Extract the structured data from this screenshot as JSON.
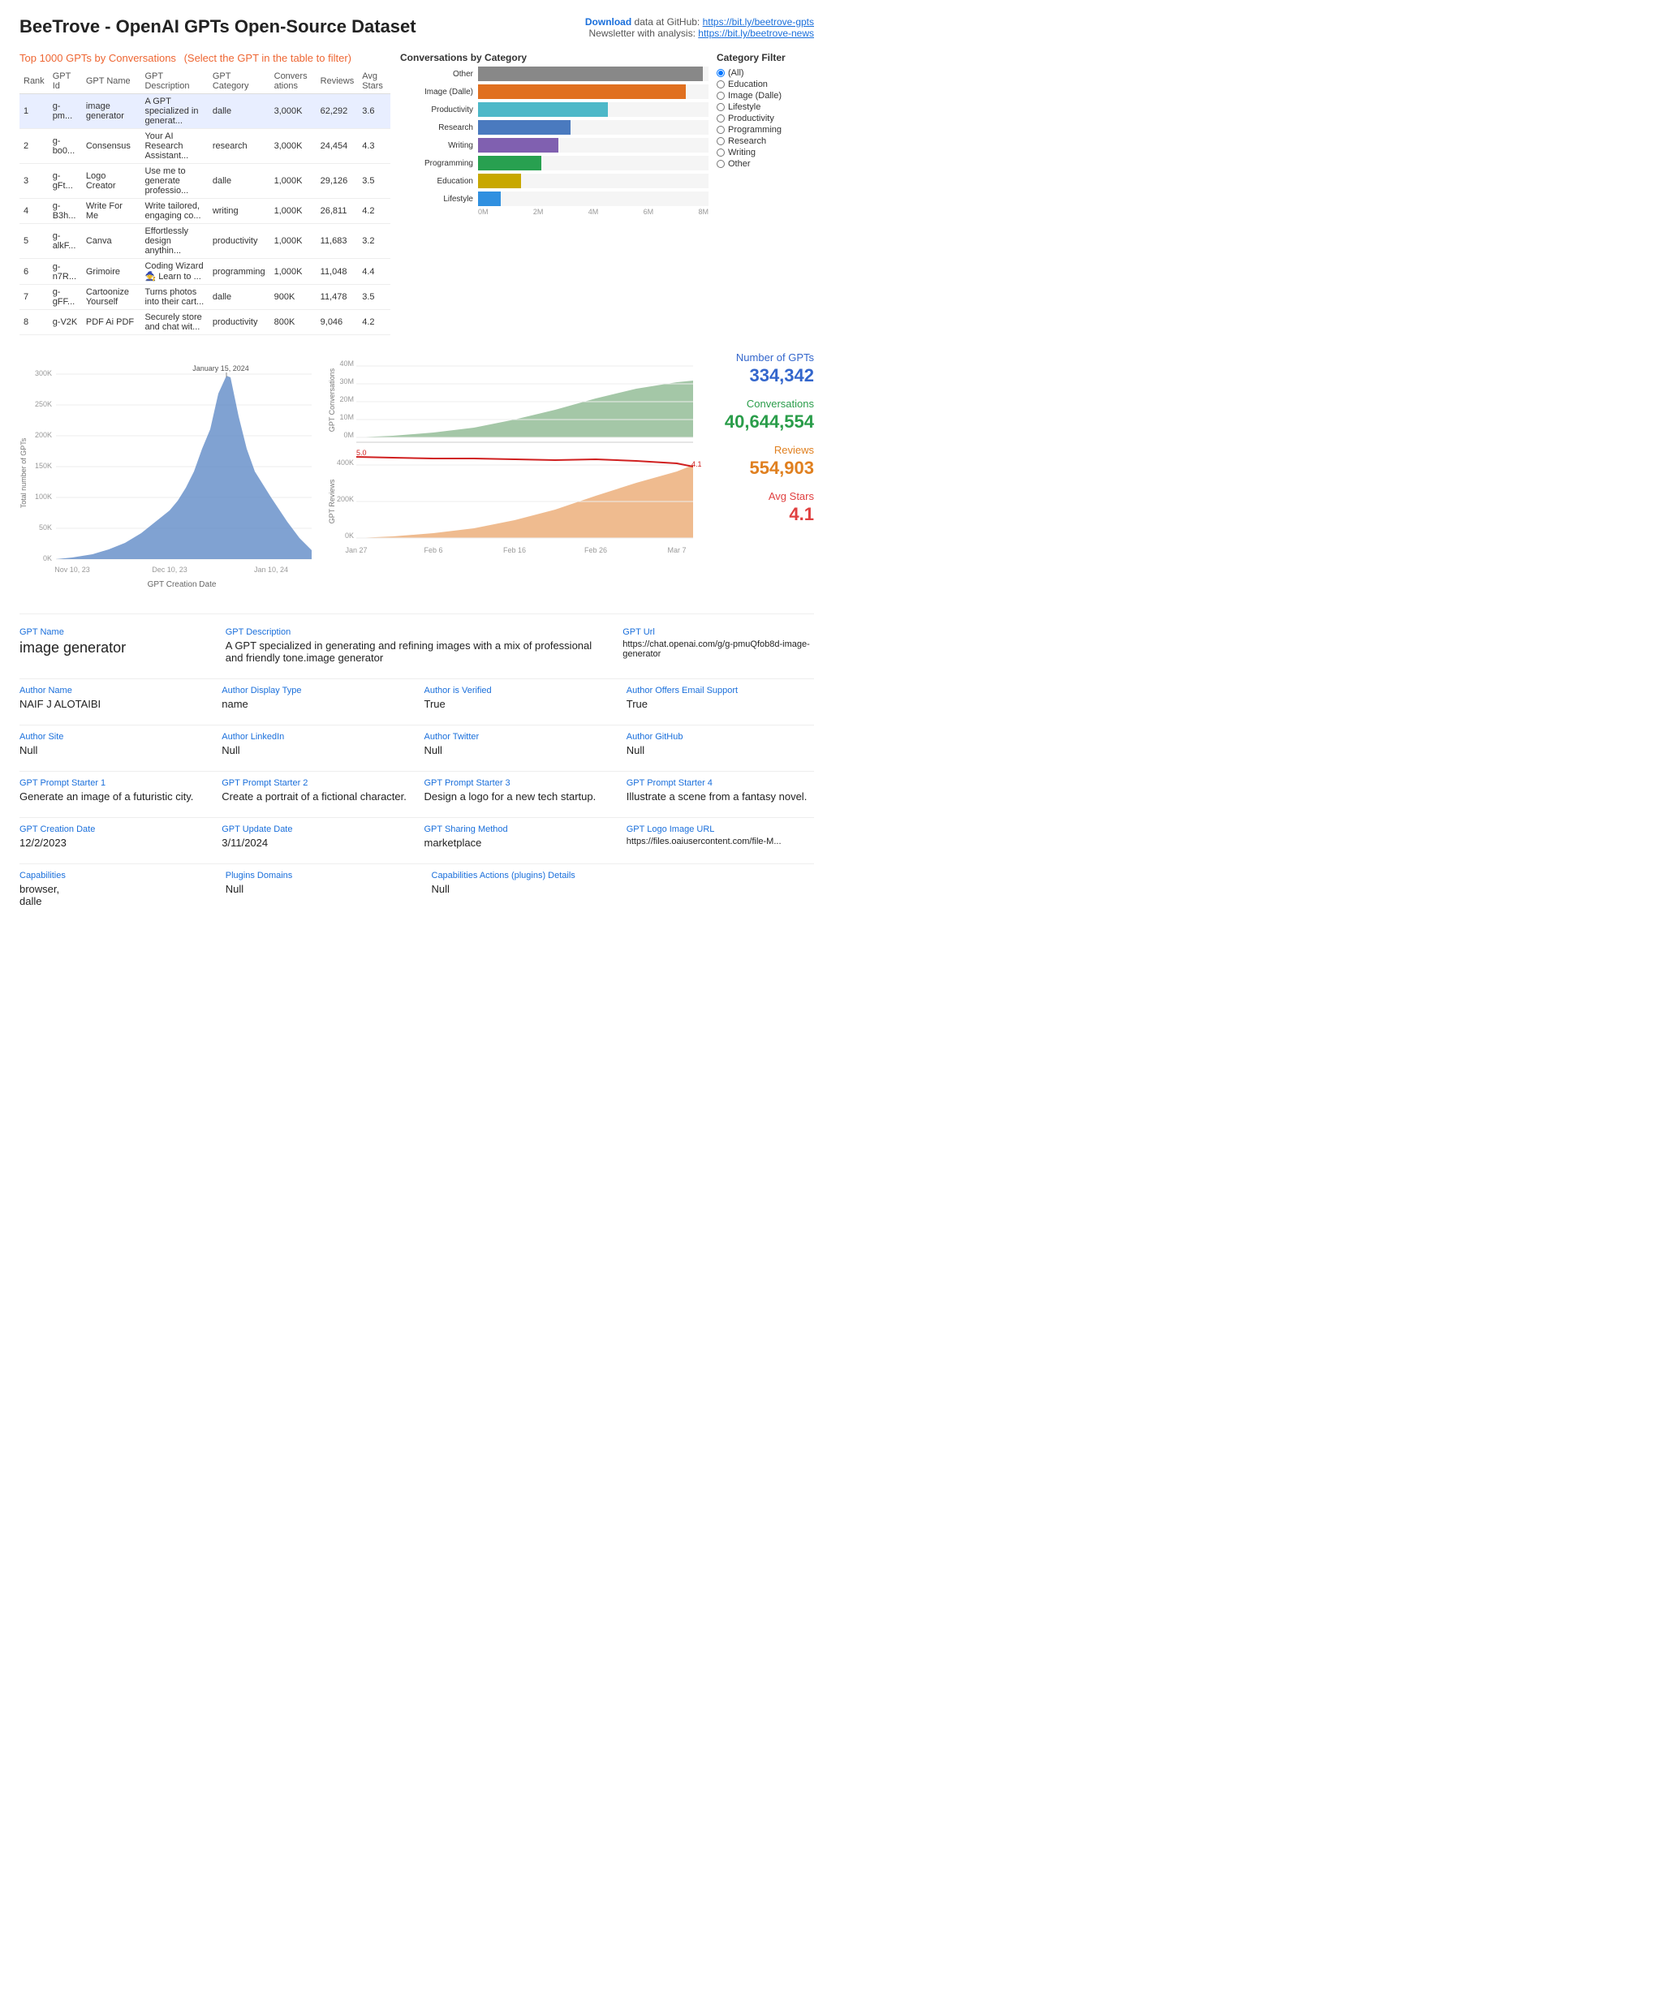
{
  "header": {
    "title": "BeeTrove - OpenAI GPTs Open-Source Dataset",
    "download_text": "Download",
    "data_at": "data at GitHub:",
    "github_url": "https://bit.ly/beetrove-gpts",
    "newsletter_label": "Newsletter",
    "newsletter_with": "with analysis:",
    "newsletter_url": "https://bit.ly/beetrove-news"
  },
  "top_table": {
    "title": "Top 1000 GPTs by Conversations",
    "filter_hint": "(Select the GPT in the table to filter)",
    "columns": [
      "Rank",
      "GPT Id",
      "GPT Name",
      "GPT Description",
      "GPT Category",
      "Conversations",
      "Reviews",
      "Avg Stars"
    ],
    "rows": [
      {
        "rank": "1",
        "id": "g-pm...",
        "name": "image generator",
        "desc": "A GPT specialized in generat...",
        "cat": "dalle",
        "conv": "3,000K",
        "reviews": "62,292",
        "stars": "3.6"
      },
      {
        "rank": "2",
        "id": "g-bo0...",
        "name": "Consensus",
        "desc": "Your AI Research Assistant...",
        "cat": "research",
        "conv": "3,000K",
        "reviews": "24,454",
        "stars": "4.3"
      },
      {
        "rank": "3",
        "id": "g-gFt...",
        "name": "Logo Creator",
        "desc": "Use me to generate professio...",
        "cat": "dalle",
        "conv": "1,000K",
        "reviews": "29,126",
        "stars": "3.5"
      },
      {
        "rank": "4",
        "id": "g-B3h...",
        "name": "Write For Me",
        "desc": "Write tailored, engaging co...",
        "cat": "writing",
        "conv": "1,000K",
        "reviews": "26,811",
        "stars": "4.2"
      },
      {
        "rank": "5",
        "id": "g-alkF...",
        "name": "Canva",
        "desc": "Effortlessly design anythin...",
        "cat": "productivity",
        "conv": "1,000K",
        "reviews": "11,683",
        "stars": "3.2"
      },
      {
        "rank": "6",
        "id": "g-n7R...",
        "name": "Grimoire",
        "desc": "Coding Wizard🧙 Learn to ...",
        "cat": "programming",
        "conv": "1,000K",
        "reviews": "11,048",
        "stars": "4.4"
      },
      {
        "rank": "7",
        "id": "g-gFF...",
        "name": "Cartoonize Yourself",
        "desc": "Turns photos into their cart...",
        "cat": "dalle",
        "conv": "900K",
        "reviews": "11,478",
        "stars": "3.5"
      },
      {
        "rank": "8",
        "id": "g-V2K",
        "name": "PDF Ai PDF",
        "desc": "Securely store and chat wit...",
        "cat": "productivity",
        "conv": "800K",
        "reviews": "9,046",
        "stars": "4.2"
      }
    ]
  },
  "bar_chart": {
    "title": "Conversations by Category",
    "bars": [
      {
        "label": "Other",
        "value": 7.8,
        "max": 8,
        "color": "#888"
      },
      {
        "label": "Image (Dalle)",
        "value": 7.2,
        "max": 8,
        "color": "#e07020"
      },
      {
        "label": "Productivity",
        "value": 4.5,
        "max": 8,
        "color": "#4db8c8"
      },
      {
        "label": "Research",
        "value": 3.2,
        "max": 8,
        "color": "#4a7abf"
      },
      {
        "label": "Writing",
        "value": 2.8,
        "max": 8,
        "color": "#8060b0"
      },
      {
        "label": "Programming",
        "value": 2.2,
        "max": 8,
        "color": "#28a050"
      },
      {
        "label": "Education",
        "value": 1.5,
        "max": 8,
        "color": "#c8a800"
      },
      {
        "label": "Lifestyle",
        "value": 0.8,
        "max": 8,
        "color": "#3090e0"
      }
    ],
    "axis_labels": [
      "0M",
      "2M",
      "4M",
      "6M",
      "8M"
    ]
  },
  "category_filter": {
    "title": "Category Filter",
    "options": [
      "(All)",
      "Education",
      "Image (Dalle)",
      "Lifestyle",
      "Productivity",
      "Programming",
      "Research",
      "Writing",
      "Other"
    ],
    "selected": "(All)"
  },
  "left_area_chart": {
    "title": "GPT Creation Date",
    "y_label": "Total number of GPTs",
    "y_ticks": [
      "300K",
      "250K",
      "200K",
      "150K",
      "100K",
      "50K",
      "0K"
    ],
    "x_ticks": [
      "Nov 10, 23",
      "Dec 10, 23",
      "Jan 10, 24"
    ],
    "peak_label": "January 15, 2024"
  },
  "right_combo_chart": {
    "y_left_label": "GPT Conversations",
    "y_left_ticks": [
      "40M",
      "30M",
      "20M",
      "10M",
      "0M"
    ],
    "y_right_label": "GPT Reviews",
    "y_right_ticks": [
      "400K",
      "200K",
      "0K"
    ],
    "x_ticks": [
      "Jan 27",
      "Feb 6",
      "Feb 16",
      "Feb 26",
      "Mar 7"
    ],
    "line_start": "5.0",
    "line_end": "4.1"
  },
  "stats": {
    "number_of_gpts_label": "Number of GPTs",
    "number_of_gpts_value": "334,342",
    "conversations_label": "Conversations",
    "conversations_value": "40,644,554",
    "reviews_label": "Reviews",
    "reviews_value": "554,903",
    "avg_stars_label": "Avg Stars",
    "avg_stars_value": "4.1"
  },
  "detail": {
    "gpt_name_label": "GPT Name",
    "gpt_name_value": "image generator",
    "gpt_desc_label": "GPT Description",
    "gpt_desc_value": "A GPT specialized in generating and refining images with a mix of professional and friendly tone.image generator",
    "gpt_url_label": "GPT Url",
    "gpt_url_value": "https://chat.openai.com/g/g-pmuQfob8d-image-generator",
    "author_name_label": "Author Name",
    "author_name_value": "NAIF J ALOTAIBI",
    "author_display_label": "Author Display Type",
    "author_display_value": "name",
    "author_verified_label": "Author is Verified",
    "author_verified_value": "True",
    "author_email_label": "Author Offers Email Support",
    "author_email_value": "True",
    "author_site_label": "Author Site",
    "author_site_value": "Null",
    "author_linkedin_label": "Author LinkedIn",
    "author_linkedin_value": "Null",
    "author_twitter_label": "Author Twitter",
    "author_twitter_value": "Null",
    "author_github_label": "Author GitHub",
    "author_github_value": "Null",
    "prompt1_label": "GPT Prompt Starter 1",
    "prompt1_value": "Generate an image of a futuristic city.",
    "prompt2_label": "GPT Prompt Starter 2",
    "prompt2_value": "Create a portrait of a fictional character.",
    "prompt3_label": "GPT Prompt Starter 3",
    "prompt3_value": "Design a logo for a new tech startup.",
    "prompt4_label": "GPT Prompt Starter 4",
    "prompt4_value": "Illustrate a scene from a fantasy novel.",
    "creation_date_label": "GPT Creation Date",
    "creation_date_value": "12/2/2023",
    "update_date_label": "GPT Update Date",
    "update_date_value": "3/11/2024",
    "sharing_label": "GPT Sharing Method",
    "sharing_value": "marketplace",
    "logo_url_label": "GPT Logo Image URL",
    "logo_url_value": "https://files.oaiusercontent.com/file-M...",
    "capabilities_label": "Capabilities",
    "capabilities_value": "browser,\ndalle",
    "plugins_label": "Plugins Domains",
    "plugins_value": "Null",
    "cap_actions_label": "Capabilities Actions (plugins) Details",
    "cap_actions_value": "Null"
  }
}
